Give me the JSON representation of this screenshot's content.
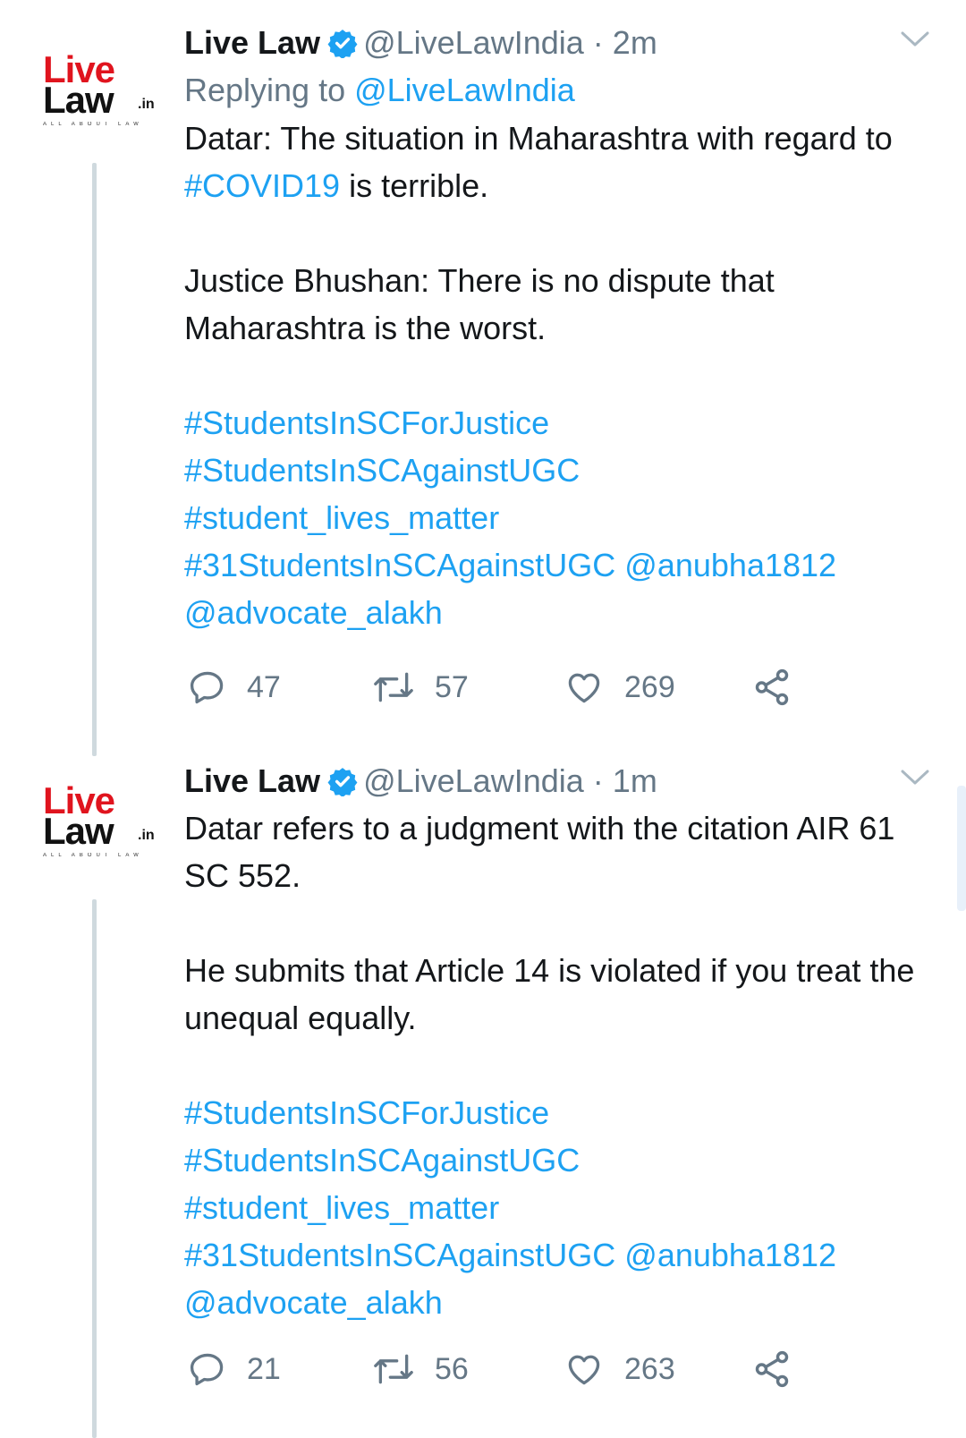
{
  "tweets": [
    {
      "author_name": "Live Law",
      "handle": "@LiveLawIndia",
      "separator": "·",
      "time": "2m",
      "reply_prefix": "Replying to ",
      "reply_handle": "@LiveLawIndia",
      "body_line1_a": "Datar: The situation in Maharashtra with regard to ",
      "body_line1_tag": "#COVID19",
      "body_line1_b": " is terrible.",
      "body_para2": "Justice Bhushan: There is no dispute that Maharashtra is the worst.",
      "tags": [
        "#StudentsInSCForJustice",
        "#StudentsInSCAgainstUGC",
        "#student_lives_matter",
        "#31StudentsInSCAgainstUGC"
      ],
      "mention1": "@anubha1812",
      "mention2": "@advocate_alakh",
      "replies": "47",
      "retweets": "57",
      "likes": "269"
    },
    {
      "author_name": "Live Law",
      "handle": "@LiveLawIndia",
      "separator": "·",
      "time": "1m",
      "body_para1": "Datar refers to a judgment with the citation AIR 61 SC 552.",
      "body_para2": "He submits that Article 14 is violated if you treat the unequal equally.",
      "tags": [
        "#StudentsInSCForJustice",
        "#StudentsInSCAgainstUGC",
        "#student_lives_matter",
        "#31StudentsInSCAgainstUGC"
      ],
      "mention1": "@anubha1812",
      "mention2": "@advocate_alakh",
      "replies": "21",
      "retweets": "56",
      "likes": "263"
    }
  ],
  "logo": {
    "word1": "Live",
    "word2": "Law",
    "suffix": ".in",
    "tagline": "ALL ABOUT LAW"
  },
  "colors": {
    "link": "#1da1f2",
    "muted": "#657786",
    "text": "#14171a",
    "thread_line": "#cfd9de",
    "brand_red": "#e0141e"
  },
  "icons": {
    "verified": "verified-badge-icon",
    "chevron": "chevron-down-icon",
    "reply": "reply-icon",
    "retweet": "retweet-icon",
    "like": "heart-icon",
    "share": "share-icon"
  }
}
